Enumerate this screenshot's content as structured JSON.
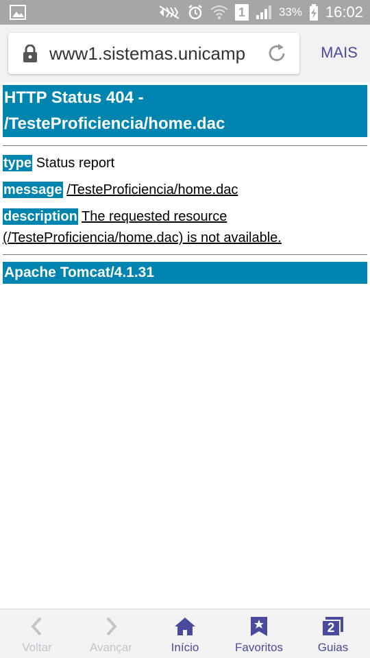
{
  "status_bar": {
    "battery": "33%",
    "time": "16:02",
    "sim": "1"
  },
  "browser": {
    "url": "www1.sistemas.unicamp",
    "more_label": "MAIS"
  },
  "page": {
    "title_line1": "HTTP Status 404 -",
    "title_line2": "/TesteProficiencia/home.dac",
    "type_label": "type",
    "type_value": "Status report",
    "message_label": "message",
    "message_value": "/TesteProficiencia/home.dac",
    "description_label": "description",
    "description_value": "The requested resource (/TesteProficiencia/home.dac) is not available.",
    "server": "Apache Tomcat/4.1.31"
  },
  "bottom_nav": {
    "back": "Voltar",
    "forward": "Avançar",
    "home": "Início",
    "bookmarks": "Favoritos",
    "tabs": "Guias",
    "tabs_count": "2"
  },
  "colors": {
    "status_bar": "#a6a6a6",
    "header_blue": "#0085b1",
    "nav_accent": "#4a4a9c",
    "nav_disabled": "#c3c3cc"
  }
}
